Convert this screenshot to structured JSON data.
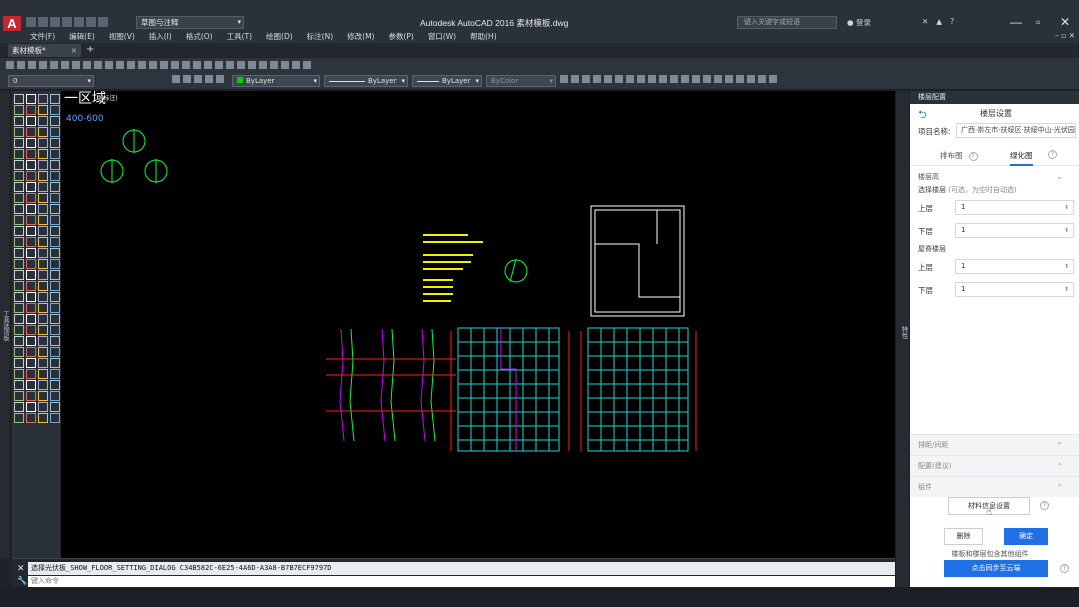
{
  "titlebar": {
    "logo": "A",
    "workspace": "草图与注释",
    "app_title": "Autodesk AutoCAD 2016   素材模板.dwg",
    "search_placeholder": "键入关键字或短语",
    "user": "登录",
    "win_min": "—",
    "win_max": "▫",
    "win_close": "✕"
  },
  "menus": [
    "文件(F)",
    "编辑(E)",
    "视图(V)",
    "插入(I)",
    "格式(O)",
    "工具(T)",
    "绘图(D)",
    "标注(N)",
    "修改(M)",
    "参数(P)",
    "窗口(W)",
    "帮助(H)"
  ],
  "doc_tab": {
    "label": "素材模板*",
    "close": "×",
    "add": "+"
  },
  "toolbar": {
    "layer_name": "0",
    "color_value": "ByLayer",
    "linetype_value": "ByLayer",
    "lineweight_value": "ByLayer",
    "plotstyle_value": "ByColor",
    "layer_combo": "0"
  },
  "canvas": {
    "label_big": "一区域",
    "label_small": "(标注)",
    "range_text": "400-600"
  },
  "command": {
    "history": "选择光伏板_SHOW_FLOOR_SETTING_DIALOG C34B582C-6E25-4A6D-A3A8-B7B7ECF9797D",
    "input_placeholder": "键入命令",
    "close": "✕"
  },
  "right_strip_label": "特性",
  "left_strip_label": "工具选项板",
  "panel": {
    "header": "楼层配置",
    "title": "楼层设置",
    "project_label": "项目名称:",
    "project_value": "广西·崇左市·扶绥区·扶绥中山·光伏园",
    "tab1": "排布图",
    "tab2": "绿化图",
    "section": "楼层高",
    "sub1_label": "选择楼层",
    "sub1_hint": "(可选，为空时自动选)",
    "upper_label": "上层",
    "upper_value": "1",
    "lower_label": "下层",
    "lower_value": "1",
    "sub2_label": "屋脊楼层",
    "upper2_label": "上层",
    "upper2_value": "1",
    "lower2_label": "下层",
    "lower2_value": "1",
    "collapse1": "排距/间距",
    "collapse2": "配置(建议)",
    "collapse3": "组件",
    "material_btn": "材料信息设置",
    "cancel": "删除",
    "ok": "确定",
    "note": "楼板和楼层包含其他组件",
    "sync": "点击同步至云端",
    "help": "?"
  }
}
